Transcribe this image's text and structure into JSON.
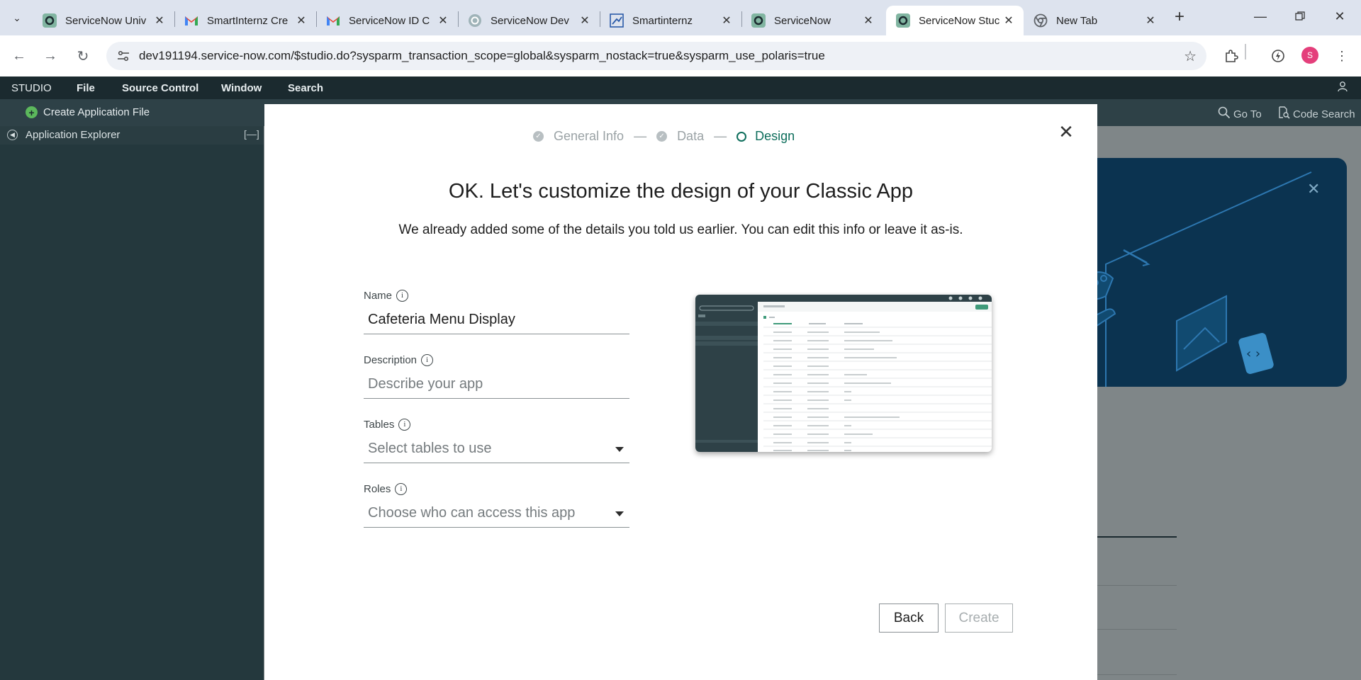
{
  "browser": {
    "tabs": [
      {
        "title": "ServiceNow Univ",
        "favicon": "servicenow-icon",
        "active": false
      },
      {
        "title": "SmartInternz Cre",
        "favicon": "gmail-icon",
        "active": false
      },
      {
        "title": "ServiceNow ID C",
        "favicon": "gmail-icon",
        "active": false
      },
      {
        "title": "ServiceNow Dev",
        "favicon": "servicenow-dev-icon",
        "active": false
      },
      {
        "title": "Smartinternz",
        "favicon": "smartinternz-icon",
        "active": false
      },
      {
        "title": "ServiceNow",
        "favicon": "servicenow-icon",
        "active": false
      },
      {
        "title": "ServiceNow Stuc",
        "favicon": "servicenow-icon",
        "active": true
      },
      {
        "title": "New Tab",
        "favicon": "chrome-icon",
        "active": false
      }
    ],
    "url": "dev191194.service-now.com/$studio.do?sysparm_transaction_scope=global&sysparm_nostack=true&sysparm_use_polaris=true",
    "profile_initial": "S"
  },
  "studio": {
    "menu": [
      "STUDIO",
      "File",
      "Source Control",
      "Window",
      "Search"
    ],
    "create_file_label": "Create Application File",
    "goto_label": "Go To",
    "code_search_label": "Code Search",
    "explorer_label": "Application Explorer",
    "explorer_collapse": "[—]"
  },
  "modal": {
    "steps": [
      {
        "label": "General Info",
        "state": "done"
      },
      {
        "label": "Data",
        "state": "done"
      },
      {
        "label": "Design",
        "state": "current"
      }
    ],
    "step_separator": "—",
    "title": "OK. Let's customize the design of your Classic App",
    "subtitle": "We already added some of the details you told us earlier. You can edit this info or leave it as-is.",
    "fields": {
      "name": {
        "label": "Name",
        "value": "Cafeteria Menu Display"
      },
      "description": {
        "label": "Description",
        "placeholder": "Describe your app"
      },
      "tables": {
        "label": "Tables",
        "placeholder": "Select tables to use"
      },
      "roles": {
        "label": "Roles",
        "placeholder": "Choose who can access this app"
      }
    },
    "back_label": "Back",
    "create_label": "Create"
  },
  "colors": {
    "accent": "#0e6e5c",
    "studio_dark": "#1b2a2f",
    "banner": "#0b3350"
  }
}
